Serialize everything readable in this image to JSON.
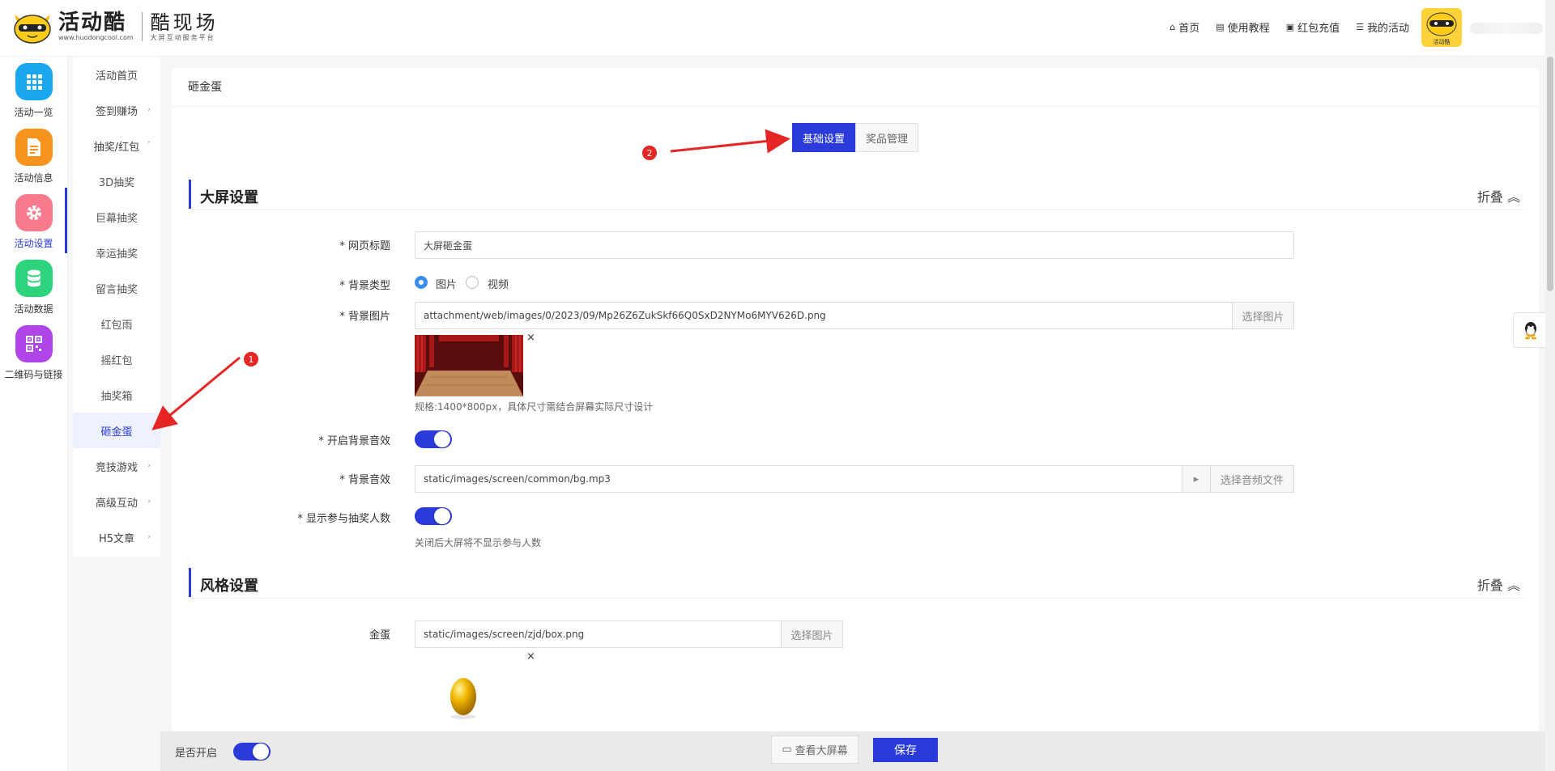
{
  "header": {
    "logo_main": "活动酷",
    "logo_url": "www.huodongcool.com",
    "logo_sub": "酷现场",
    "logo_sub_small": "大屏互动服务平台",
    "nav": [
      {
        "icon": "home-icon",
        "label": "首页"
      },
      {
        "icon": "book-icon",
        "label": "使用教程"
      },
      {
        "icon": "wallet-icon",
        "label": "红包充值"
      },
      {
        "icon": "list-icon",
        "label": "我的活动"
      }
    ],
    "avatar_caption": "活动酷"
  },
  "rail": [
    {
      "label": "活动一览",
      "color": "#1ba7f0",
      "icon": "grid-icon"
    },
    {
      "label": "活动信息",
      "color": "#f7931e",
      "icon": "document-icon"
    },
    {
      "label": "活动设置",
      "color": "#f77b8c",
      "icon": "gear-icon",
      "active": true
    },
    {
      "label": "活动数据",
      "color": "#2ed37d",
      "icon": "database-icon"
    },
    {
      "label": "二维码与链接",
      "color": "#b045e8",
      "icon": "qrcode-icon"
    }
  ],
  "submenu": [
    {
      "label": "活动首页"
    },
    {
      "label": "签到赚场",
      "chev": "›"
    },
    {
      "label": "抽奖/红包",
      "chev": "ˇ"
    },
    {
      "label": "3D抽奖",
      "child": true
    },
    {
      "label": "巨幕抽奖",
      "child": true
    },
    {
      "label": "幸运抽奖",
      "child": true
    },
    {
      "label": "留言抽奖",
      "child": true
    },
    {
      "label": "红包雨",
      "child": true
    },
    {
      "label": "摇红包",
      "child": true
    },
    {
      "label": "抽奖箱",
      "child": true
    },
    {
      "label": "砸金蛋",
      "child": true,
      "active": true
    },
    {
      "label": "竞技游戏",
      "chev": "›"
    },
    {
      "label": "高级互动",
      "chev": "›"
    },
    {
      "label": "H5文章",
      "chev": "›"
    }
  ],
  "panel": {
    "title": "砸金蛋",
    "tabs": [
      "基础设置",
      "奖品管理"
    ],
    "section1": {
      "title": "大屏设置",
      "fold": "折叠 ︽",
      "page_title_label": "* 网页标题",
      "page_title_value": "大屏砸金蛋",
      "bg_type_label": "* 背景类型",
      "bg_type_options": [
        "图片",
        "视频"
      ],
      "bg_image_label": "* 背景图片",
      "bg_image_value": "attachment/web/images/0/2023/09/Mp26Z6ZukSkf66Q0SxD2NYMo6MYV626D.png",
      "select_image": "选择图片",
      "bg_image_hint": "规格:1400*800px，具体尺寸需结合屏幕实际尺寸设计",
      "bg_music_toggle_label": "* 开启背景音效",
      "bg_music_label": "* 背景音效",
      "bg_music_value": "static/images/screen/common/bg.mp3",
      "play_symbol": "▸",
      "select_audio": "选择音频文件",
      "show_count_label": "* 显示参与抽奖人数",
      "show_count_hint": "关闭后大屏将不显示参与人数"
    },
    "section2": {
      "title": "风格设置",
      "fold": "折叠 ︽",
      "egg_label": "金蛋",
      "egg_value": "static/images/screen/zjd/box.png",
      "select_image": "选择图片"
    },
    "close_symbol": "×"
  },
  "bottom": {
    "enable_label": "是否开启",
    "preview_label": "查看大屏幕",
    "save_label": "保存"
  },
  "annotations": [
    "1",
    "2"
  ],
  "colors": {
    "accent": "#2a3bda",
    "annotation": "#e62525"
  }
}
